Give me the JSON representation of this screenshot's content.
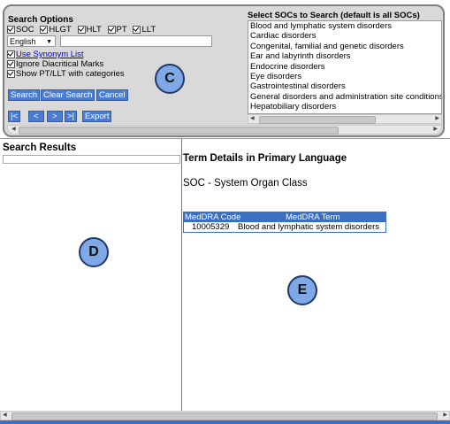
{
  "search_options": {
    "title": "Search Options",
    "levels": [
      {
        "label": "SOC",
        "checked": true
      },
      {
        "label": "HLGT",
        "checked": true
      },
      {
        "label": "HLT",
        "checked": true
      },
      {
        "label": "PT",
        "checked": true
      },
      {
        "label": "LLT",
        "checked": true
      }
    ],
    "language": "English",
    "search_value": "",
    "use_synonym_label": "Use Synonym List",
    "ignore_diacritical_label": "Ignore Diacritical Marks",
    "show_pt_llt_label": "Show PT/LLT with categories",
    "buttons": {
      "search": "Search",
      "clear": "Clear Search",
      "cancel": "Cancel"
    },
    "nav": {
      "first": "|<",
      "prev": "<",
      "next": ">",
      "last": ">|",
      "export": "Export"
    }
  },
  "soc_select": {
    "title": "Select SOCs to Search (default is all SOCs)",
    "items": [
      "Blood and lymphatic system disorders",
      "Cardiac disorders",
      "Congenital, familial and genetic disorders",
      "Ear and labyrinth disorders",
      "Endocrine disorders",
      "Eye disorders",
      "Gastrointestinal disorders",
      "General disorders and administration site conditions",
      "Hepatobiliary disorders"
    ]
  },
  "markers": {
    "c": "C",
    "d": "D",
    "e": "E"
  },
  "results": {
    "title": "Search Results"
  },
  "details": {
    "title": "Term Details in Primary Language",
    "level_heading": "SOC - System Organ Class",
    "table": {
      "col_code": "MedDRA Code",
      "col_term": "MedDRA Term",
      "code": "10005329",
      "term": "Blood and lymphatic system disorders"
    }
  },
  "colors": {
    "accent": "#3a6fc1",
    "marker_fill": "#7fa9e6",
    "panel_bg": "#d9d9d9"
  }
}
